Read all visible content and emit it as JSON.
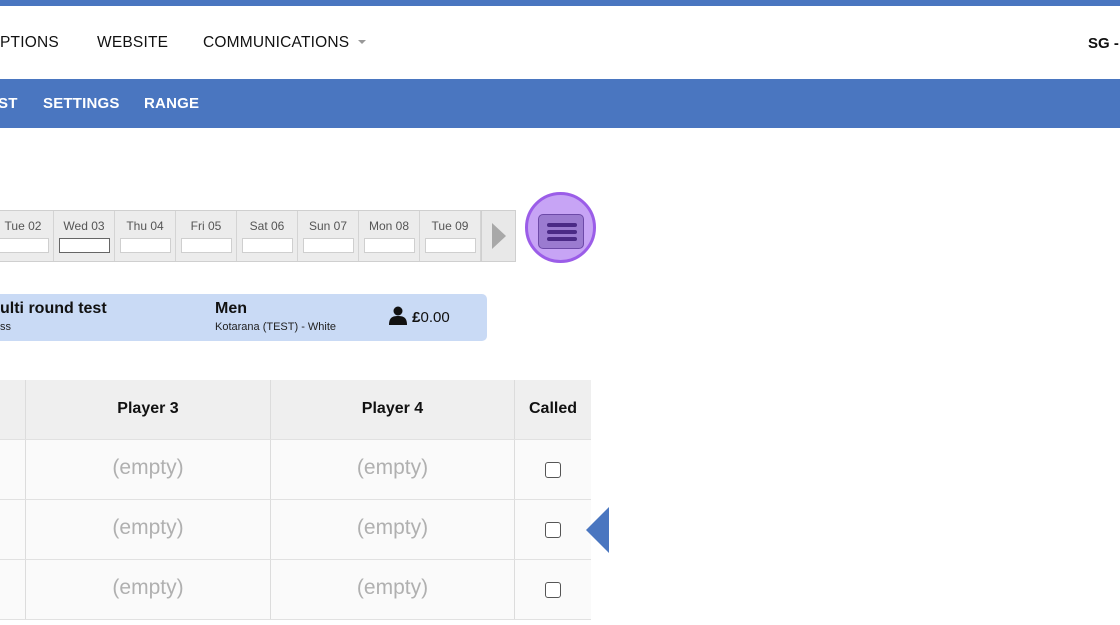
{
  "nav": {
    "items": [
      "PTIONS",
      "WEBSITE",
      "COMMUNICATIONS"
    ],
    "user_label": "SG -"
  },
  "subnav": {
    "items": [
      "ST",
      "SETTINGS",
      "RANGE"
    ]
  },
  "date_strip": {
    "days": [
      "Tue 02",
      "Wed 03",
      "Thu 04",
      "Fri 05",
      "Sat 06",
      "Sun 07",
      "Mon 08",
      "Tue 09"
    ],
    "selected_index": 1
  },
  "info": {
    "title": "ulti round test",
    "subtitle": "ss",
    "category": "Men",
    "course": "Kotarana (TEST) - White",
    "currency": "£",
    "price": "0.00"
  },
  "table": {
    "headers": [
      "Player 3",
      "Player 4",
      "Called"
    ],
    "rows": [
      {
        "player3": "(empty)",
        "player4": "(empty)",
        "called": false
      },
      {
        "player3": "(empty)",
        "player4": "(empty)",
        "called": false
      },
      {
        "player3": "(empty)",
        "player4": "(empty)",
        "called": false
      }
    ]
  },
  "colors": {
    "brand": "#4a76c0",
    "info_panel": "#c9daf5",
    "menu_button": "#c7a4f5"
  },
  "icons": [
    "hamburger-menu-icon",
    "person-icon",
    "chevron-right-icon",
    "pointer-arrow-icon",
    "dropdown-caret-icon"
  ]
}
